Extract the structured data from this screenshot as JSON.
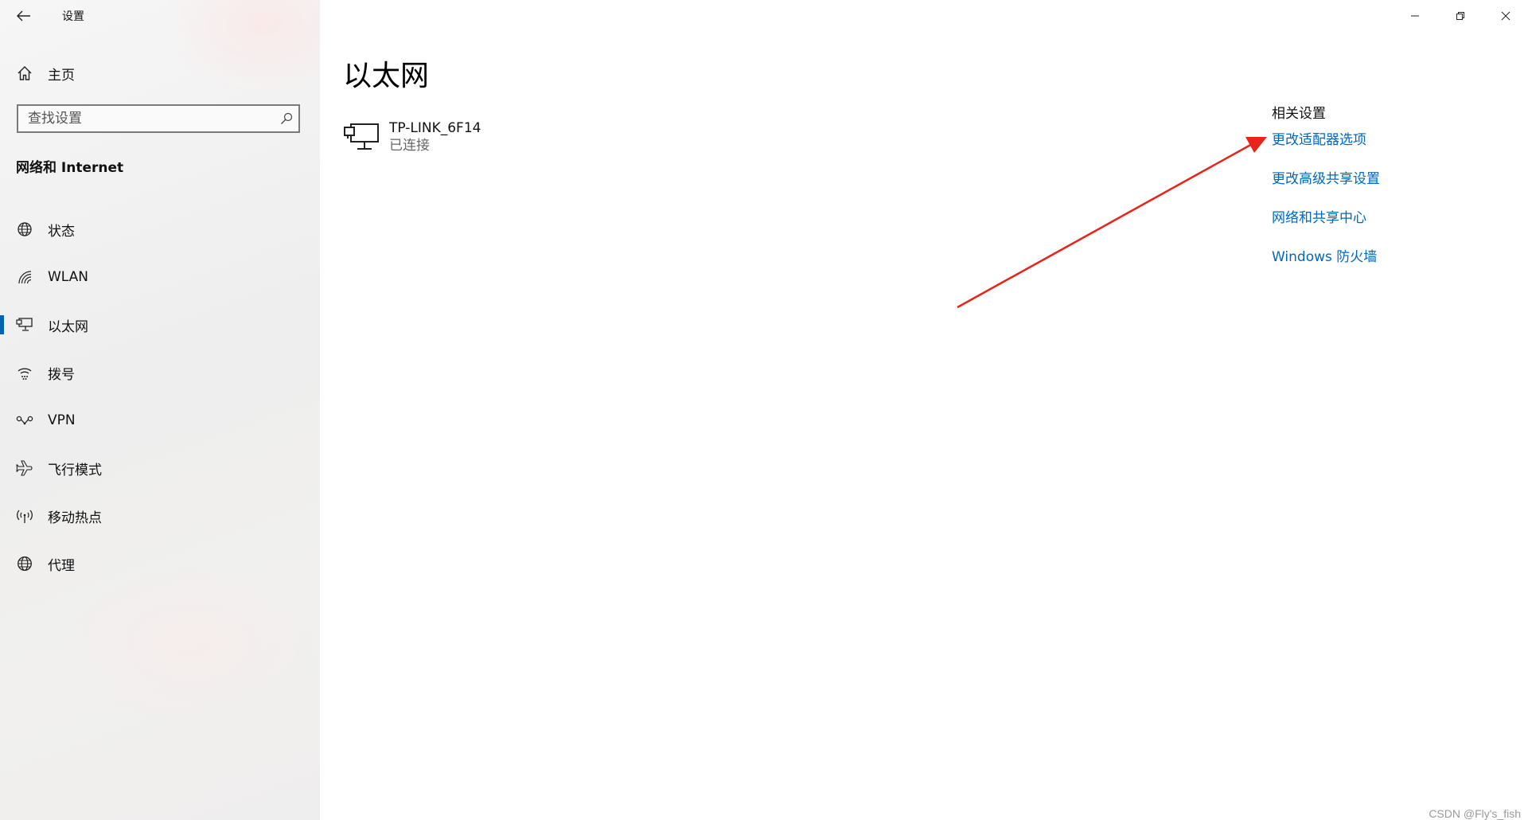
{
  "app": {
    "title": "设置"
  },
  "sidebar": {
    "home_label": "主页",
    "search_placeholder": "查找设置",
    "section_header": "网络和 Internet",
    "items": [
      {
        "label": "状态",
        "icon": "globe-status-icon"
      },
      {
        "label": "WLAN",
        "icon": "wifi-icon"
      },
      {
        "label": "以太网",
        "icon": "ethernet-icon",
        "selected": true
      },
      {
        "label": "拨号",
        "icon": "dialup-icon"
      },
      {
        "label": "VPN",
        "icon": "vpn-icon"
      },
      {
        "label": "飞行模式",
        "icon": "airplane-icon"
      },
      {
        "label": "移动热点",
        "icon": "hotspot-icon"
      },
      {
        "label": "代理",
        "icon": "globe-icon"
      }
    ]
  },
  "main": {
    "title": "以太网",
    "network": {
      "name": "TP-LINK_6F14",
      "status": "已连接"
    },
    "related": {
      "title": "相关设置",
      "links": [
        "更改适配器选项",
        "更改高级共享设置",
        "网络和共享中心",
        "Windows 防火墙"
      ]
    }
  },
  "watermark": "CSDN @Fly's_fish",
  "colors": {
    "accent": "#0063b1",
    "link": "#0067c0",
    "annotation_arrow": "#e8231b"
  }
}
